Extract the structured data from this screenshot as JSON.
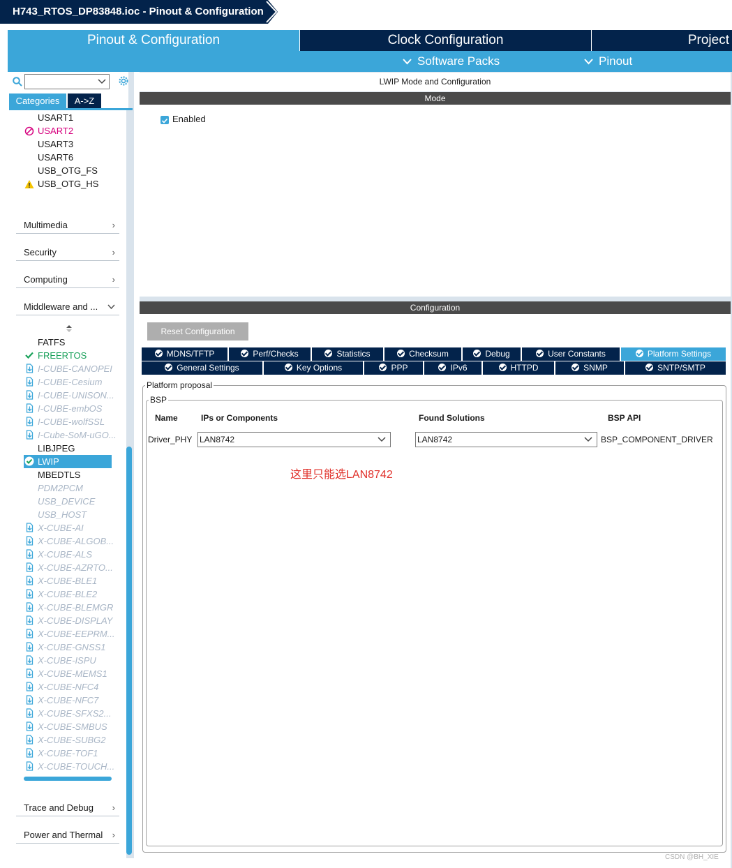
{
  "window": {
    "title": "H743_RTOS_DP83848.ioc - Pinout & Configuration"
  },
  "top_tabs": [
    {
      "label": "Pinout & Configuration",
      "active": true
    },
    {
      "label": "Clock Configuration",
      "active": false
    },
    {
      "label": "Project",
      "active": false
    }
  ],
  "sub_tabs": [
    {
      "label": "Software Packs"
    },
    {
      "label": "Pinout"
    }
  ],
  "sidebar": {
    "search_value": "",
    "category_tabs": [
      {
        "label": "Categories",
        "active": true
      },
      {
        "label": "A->Z",
        "active": false
      }
    ],
    "connectivity_items": [
      {
        "label": "USART1",
        "state": "normal"
      },
      {
        "label": "USART2",
        "state": "error"
      },
      {
        "label": "USART3",
        "state": "normal"
      },
      {
        "label": "USART6",
        "state": "normal"
      },
      {
        "label": "USB_OTG_FS",
        "state": "normal"
      },
      {
        "label": "USB_OTG_HS",
        "state": "warning"
      }
    ],
    "groups_top": [
      {
        "label": "Multimedia"
      },
      {
        "label": "Security"
      },
      {
        "label": "Computing"
      },
      {
        "label": "Middleware and ..."
      }
    ],
    "middleware_items": [
      {
        "label": "FATFS",
        "state": "normal"
      },
      {
        "label": "FREERTOS",
        "state": "enabled"
      },
      {
        "label": "I-CUBE-CANOPEI",
        "state": "pack"
      },
      {
        "label": "I-CUBE-Cesium",
        "state": "pack"
      },
      {
        "label": "I-CUBE-UNISON...",
        "state": "pack"
      },
      {
        "label": "I-CUBE-embOS",
        "state": "pack"
      },
      {
        "label": "I-CUBE-wolfSSL",
        "state": "pack"
      },
      {
        "label": "I-Cube-SoM-uGO...",
        "state": "pack"
      },
      {
        "label": "LIBJPEG",
        "state": "normal"
      },
      {
        "label": "LWIP",
        "state": "selected"
      },
      {
        "label": "MBEDTLS",
        "state": "normal"
      },
      {
        "label": "PDM2PCM",
        "state": "disabled"
      },
      {
        "label": "USB_DEVICE",
        "state": "disabled"
      },
      {
        "label": "USB_HOST",
        "state": "disabled"
      },
      {
        "label": "X-CUBE-AI",
        "state": "pack"
      },
      {
        "label": "X-CUBE-ALGOB...",
        "state": "pack"
      },
      {
        "label": "X-CUBE-ALS",
        "state": "pack"
      },
      {
        "label": "X-CUBE-AZRTO...",
        "state": "pack"
      },
      {
        "label": "X-CUBE-BLE1",
        "state": "pack"
      },
      {
        "label": "X-CUBE-BLE2",
        "state": "pack"
      },
      {
        "label": "X-CUBE-BLEMGR",
        "state": "pack"
      },
      {
        "label": "X-CUBE-DISPLAY",
        "state": "pack"
      },
      {
        "label": "X-CUBE-EEPRM...",
        "state": "pack"
      },
      {
        "label": "X-CUBE-GNSS1",
        "state": "pack"
      },
      {
        "label": "X-CUBE-ISPU",
        "state": "pack"
      },
      {
        "label": "X-CUBE-MEMS1",
        "state": "pack"
      },
      {
        "label": "X-CUBE-NFC4",
        "state": "pack"
      },
      {
        "label": "X-CUBE-NFC7",
        "state": "pack"
      },
      {
        "label": "X-CUBE-SFXS2...",
        "state": "pack"
      },
      {
        "label": "X-CUBE-SMBUS",
        "state": "pack"
      },
      {
        "label": "X-CUBE-SUBG2",
        "state": "pack"
      },
      {
        "label": "X-CUBE-TOF1",
        "state": "pack"
      },
      {
        "label": "X-CUBE-TOUCH...",
        "state": "pack"
      }
    ],
    "groups_bottom": [
      {
        "label": "Trace and Debug"
      },
      {
        "label": "Power and Thermal"
      }
    ]
  },
  "main": {
    "title": "LWIP Mode and Configuration",
    "mode_header": "Mode",
    "enabled_label": "Enabled",
    "enabled_checked": true,
    "config_header": "Configuration",
    "reset_button": "Reset Configuration",
    "param_tabs_row1": [
      {
        "label": "MDNS/TFTP"
      },
      {
        "label": "Perf/Checks"
      },
      {
        "label": "Statistics"
      },
      {
        "label": "Checksum"
      },
      {
        "label": "Debug"
      },
      {
        "label": "User Constants"
      },
      {
        "label": "Platform Settings",
        "active": true
      }
    ],
    "param_tabs_row2": [
      {
        "label": "General Settings"
      },
      {
        "label": "Key Options"
      },
      {
        "label": "PPP"
      },
      {
        "label": "IPv6"
      },
      {
        "label": "HTTPD"
      },
      {
        "label": "SNMP"
      },
      {
        "label": "SNTP/SMTP"
      }
    ],
    "platform_proposal_legend": "Platform proposal",
    "bsp_legend": "BSP",
    "columns": {
      "name": "Name",
      "ips": "IPs or Components",
      "found": "Found Solutions",
      "api": "BSP API"
    },
    "row": {
      "name": "Driver_PHY",
      "ips_value": "LAN8742",
      "found_value": "LAN8742",
      "api": "BSP_COMPONENT_DRIVER"
    },
    "annotation": "这里只能选LAN8742"
  },
  "watermark": "CSDN @BH_XIE",
  "colors": {
    "navy": "#03234b",
    "accent": "#3ba6d9",
    "error": "#d6007e",
    "ok": "#19a15a",
    "warn": "#f5c400",
    "annotation": "#e0302a"
  }
}
